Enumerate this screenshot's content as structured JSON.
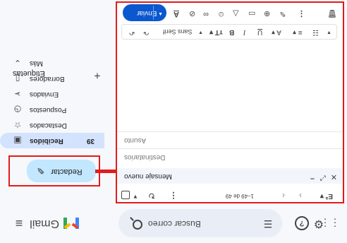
{
  "app": {
    "name": "Gmail"
  },
  "topbar": {
    "search_placeholder": "Buscar correo",
    "icons": [
      "apps-icon",
      "settings-icon",
      "help-icon",
      "tune-icon",
      "menu-icon",
      "search-icon"
    ]
  },
  "sidebar": {
    "compose_label": "Redactar",
    "items": [
      {
        "label": "Recibidos",
        "count": "39",
        "icon": "inbox-icon",
        "active": true
      },
      {
        "label": "Destacados",
        "count": "",
        "icon": "star-icon",
        "active": false
      },
      {
        "label": "Pospuestos",
        "count": "",
        "icon": "clock-icon",
        "active": false
      },
      {
        "label": "Enviados",
        "count": "",
        "icon": "send-icon",
        "active": false
      },
      {
        "label": "Borradores",
        "count": "",
        "icon": "draft-icon",
        "active": false
      },
      {
        "label": "Más",
        "count": "",
        "icon": "chevron-down-icon",
        "active": false
      }
    ],
    "labels_title": "Etiquetas"
  },
  "list_toolbar": {
    "range": "1–49 de 49"
  },
  "compose_window": {
    "title": "Mensaje nuevo",
    "to_placeholder": "Destinatarios",
    "subject_placeholder": "Asunto",
    "font_name": "Sans Serif",
    "send_label": "Enviar"
  },
  "colors": {
    "accent": "#0b57d0",
    "compose_bg": "#c2e7ff",
    "active_nav": "#d3e3fd",
    "highlight": "#e21b1b"
  }
}
